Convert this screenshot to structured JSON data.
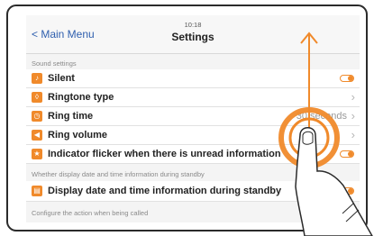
{
  "header": {
    "back_label": "< Main Menu",
    "time": "10:18",
    "title": "Settings"
  },
  "sections": {
    "sound": "Sound settings",
    "standby": "Whether display date and time information during standby",
    "called": "Configure the action when being called"
  },
  "rows": {
    "silent": {
      "label": "Silent",
      "icon": "bell-silent-icon",
      "toggle_on": true
    },
    "ringtone": {
      "label": "Ringtone type",
      "icon": "bell-icon"
    },
    "ring_time": {
      "label": "Ring time",
      "value": "30 seconds",
      "icon": "clock-icon"
    },
    "ring_volume": {
      "label": "Ring volume",
      "icon": "speaker-icon"
    },
    "indicator": {
      "label": "Indicator flicker when there is unread information",
      "icon": "star-icon",
      "toggle_on": true
    },
    "display_datetime": {
      "label": "Display date and time information during standby",
      "icon": "calendar-icon",
      "toggle_on": true
    }
  },
  "colors": {
    "accent": "#f08a2b",
    "link": "#2f5fae"
  }
}
